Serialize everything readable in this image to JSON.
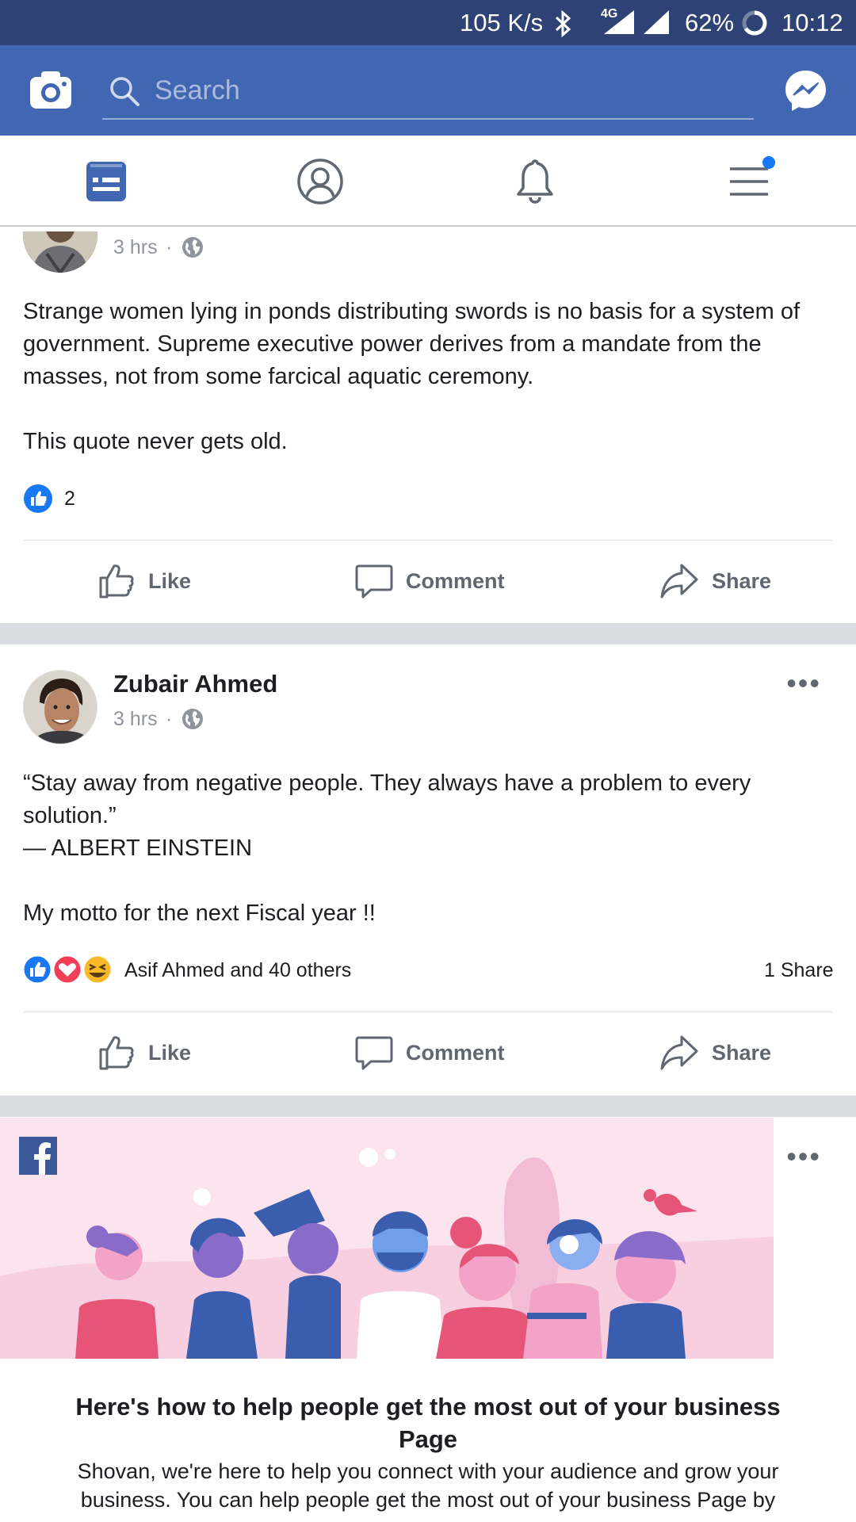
{
  "status_bar": {
    "speed": "105 K/s",
    "network": "4G",
    "battery": "62%",
    "time": "10:12"
  },
  "header": {
    "search_placeholder": "Search"
  },
  "posts": [
    {
      "time": "3 hrs",
      "text": "Strange women lying in ponds distributing swords is no basis for a system of government. Supreme executive power derives from a mandate from the masses, not from some farcical aquatic ceremony.\n\nThis quote never gets old.",
      "reaction_count": "2",
      "actions": {
        "like": "Like",
        "comment": "Comment",
        "share": "Share"
      }
    },
    {
      "author": "Zubair Ahmed",
      "time": "3 hrs",
      "text": "“Stay away from negative people. They always have a problem to every solution.”\n— ALBERT EINSTEIN\n\nMy motto for the next Fiscal year !!",
      "reactions_text": "Asif Ahmed and 40 others",
      "shares": "1 Share",
      "actions": {
        "like": "Like",
        "comment": "Comment",
        "share": "Share"
      }
    }
  ],
  "business_card": {
    "title": "Here's how to help people get the most out of your business Page",
    "body": "Shovan, we're here to help you connect with your audience and grow your business. You can help people get the most out of your business Page by"
  },
  "colors": {
    "brand": "#4267b2",
    "status_bar": "#2e4275",
    "like_blue": "#1877f2",
    "notification_dot": "#1877f2"
  },
  "icons": {
    "header_left": "camera-icon",
    "header_right": "messenger-icon",
    "tabs": [
      "news-feed-icon",
      "profile-icon",
      "bell-icon",
      "menu-icon"
    ]
  }
}
